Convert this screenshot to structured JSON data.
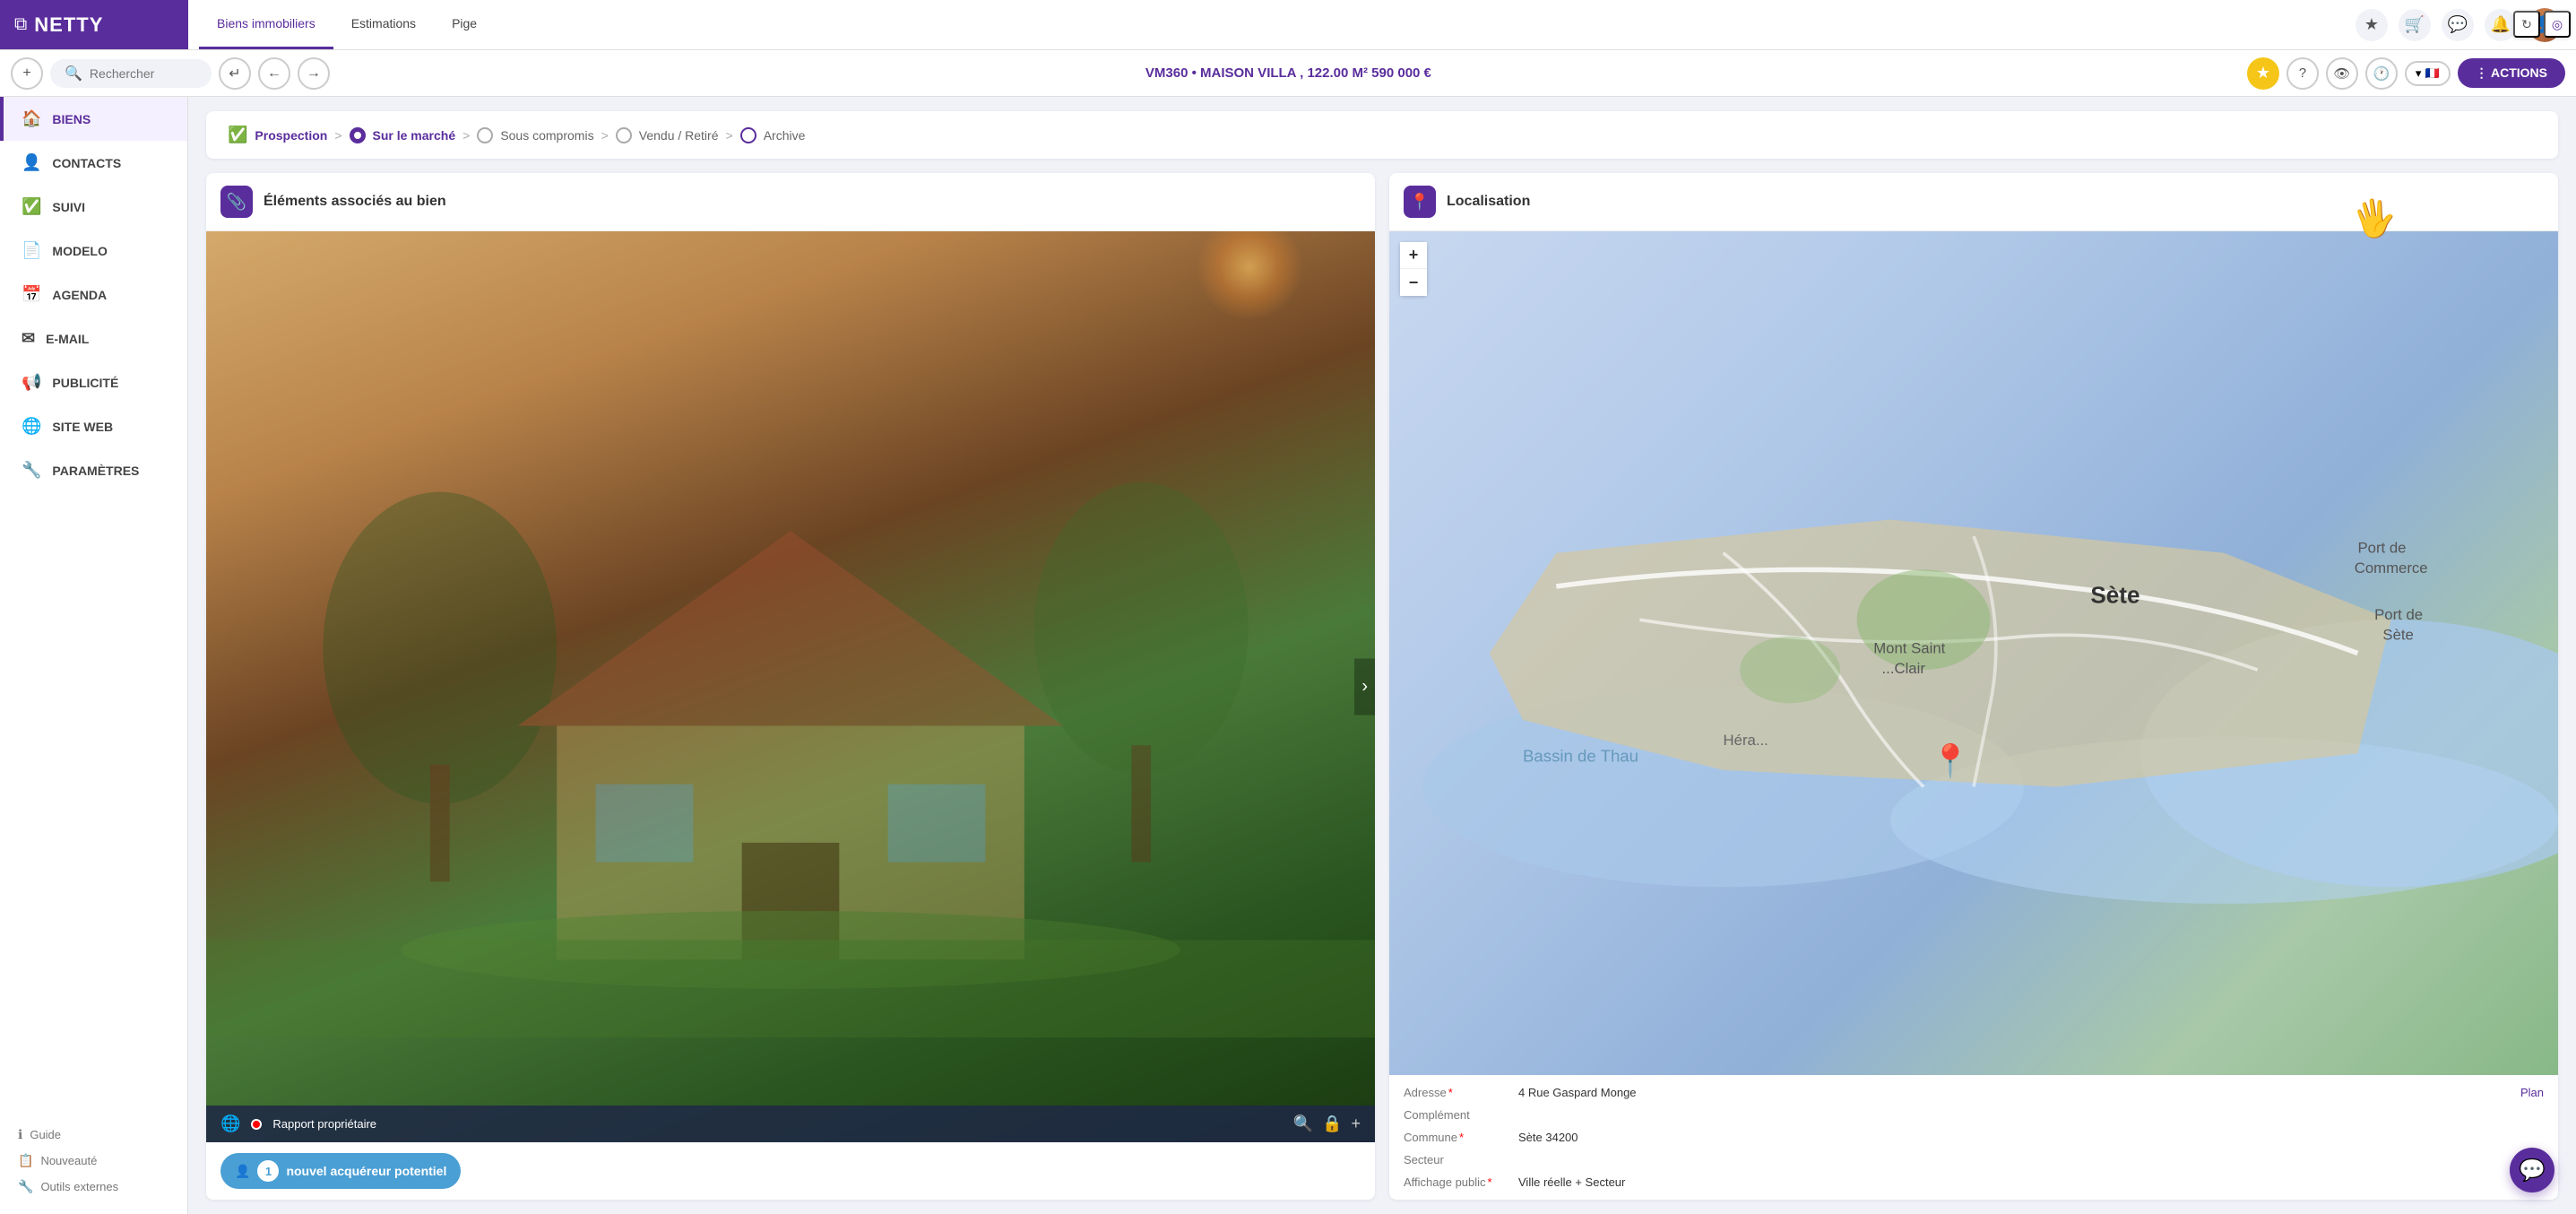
{
  "app": {
    "logo": "NETTY",
    "logo_icon": "⧉"
  },
  "top_nav": {
    "tabs": [
      {
        "id": "biens",
        "label": "Biens immobiliers",
        "active": true
      },
      {
        "id": "estimations",
        "label": "Estimations",
        "active": false
      },
      {
        "id": "pige",
        "label": "Pige",
        "active": false
      }
    ],
    "search_placeholder": "Rechercher",
    "icons": {
      "star": "★",
      "cart": "🛒",
      "chat": "💬",
      "bell": "🔔"
    }
  },
  "second_bar": {
    "breadcrumb": "VM360 • MAISON VILLA , 122.00 M² 590 000 €",
    "star_icon": "★",
    "help_icon": "?",
    "eye_icon": "👁",
    "clock_icon": "🕐",
    "flag": "🇫🇷",
    "actions_label": "⋮ ACTIONS"
  },
  "sidebar": {
    "items": [
      {
        "id": "biens",
        "icon": "🏠",
        "label": "BIENS",
        "active": true
      },
      {
        "id": "contacts",
        "icon": "👤",
        "label": "CONTACTS",
        "active": false
      },
      {
        "id": "suivi",
        "icon": "✅",
        "label": "SUIVI",
        "active": false
      },
      {
        "id": "modelo",
        "icon": "📄",
        "label": "MODELO",
        "active": false
      },
      {
        "id": "agenda",
        "icon": "📅",
        "label": "AGENDA",
        "active": false
      },
      {
        "id": "email",
        "icon": "✉",
        "label": "E-MAIL",
        "active": false
      },
      {
        "id": "publicite",
        "icon": "📢",
        "label": "PUBLICITÉ",
        "active": false
      },
      {
        "id": "siteweb",
        "icon": "🌐",
        "label": "SITE WEB",
        "active": false
      },
      {
        "id": "parametres",
        "icon": "🔧",
        "label": "PARAMÈTRES",
        "active": false
      }
    ],
    "links": [
      {
        "id": "guide",
        "icon": "ℹ",
        "label": "Guide"
      },
      {
        "id": "nouveaute",
        "icon": "📋",
        "label": "Nouveauté"
      },
      {
        "id": "outils",
        "icon": "🔧",
        "label": "Outils externes"
      }
    ]
  },
  "status_bar": {
    "steps": [
      {
        "id": "prospection",
        "label": "Prospection",
        "state": "done"
      },
      {
        "id": "sur_le_marche",
        "label": "Sur le marché",
        "state": "active"
      },
      {
        "id": "sous_compromis",
        "label": "Sous compromis",
        "state": "pending"
      },
      {
        "id": "vendu_retire",
        "label": "Vendu / Retiré",
        "state": "pending"
      },
      {
        "id": "archive",
        "label": "Archive",
        "state": "pending"
      }
    ],
    "arrow": ">"
  },
  "property_card": {
    "title": "Éléments associés au bien",
    "icon": "📎",
    "image_footer": {
      "label": "Rapport propriétaire",
      "icons": [
        "🔍",
        "🔒",
        "+"
      ]
    },
    "acquereur": {
      "count": "1",
      "label": "nouvel acquéreur potentiel",
      "icon": "👤"
    }
  },
  "localisation_card": {
    "title": "Localisation",
    "icon": "📍",
    "map_zoom_plus": "+",
    "map_zoom_minus": "−",
    "address_label": "Adresse",
    "address_value": "4 Rue Gaspard Monge",
    "plan_link": "Plan",
    "complement_label": "Complément",
    "complement_value": "",
    "commune_label": "Commune",
    "commune_value": "Sète 34200",
    "secteur_label": "Secteur",
    "secteur_value": "",
    "affichage_label": "Affichage public",
    "affichage_value": "Ville réelle + Secteur",
    "city_label": "Sète",
    "refresh_icon": "↻",
    "target_icon": "◎"
  },
  "chat_fab": {
    "icon": "💬"
  },
  "cursor": {
    "icon": "🖐"
  }
}
